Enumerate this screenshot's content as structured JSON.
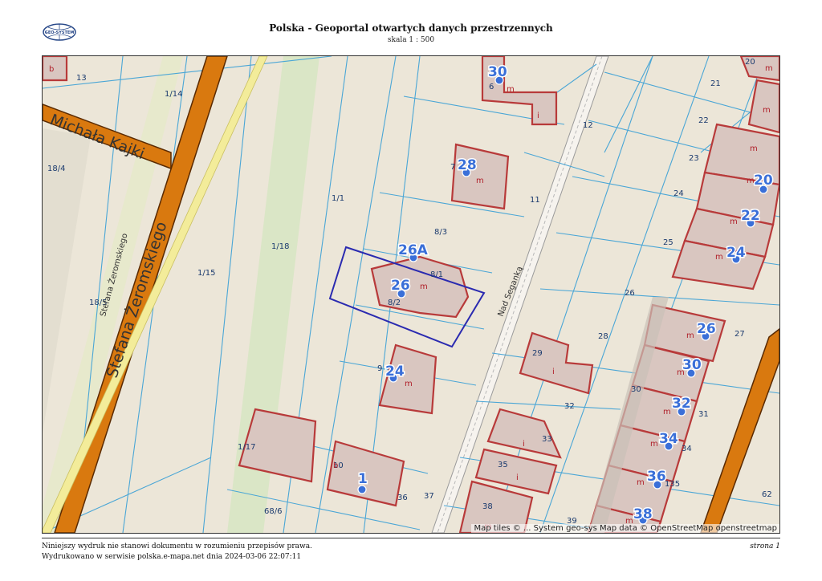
{
  "header": {
    "title": "Polska - Geoportal otwartych danych przestrzennych",
    "scale": "skala 1 : 500",
    "logo_text": "GEO-SYSTEM"
  },
  "map": {
    "streets": [
      "Michała Kajki",
      "Stefana Żeromskiego",
      "Stefana Żeromskiego",
      "Nad Seganką"
    ],
    "parcels": [
      "13",
      "1/14",
      "18/4",
      "1/1",
      "1/18",
      "1/15",
      "18/5",
      "8/3",
      "8/1",
      "8/2",
      "1/17",
      "10",
      "68/6",
      "36",
      "37",
      "38",
      "39",
      "11",
      "12",
      "20",
      "21",
      "22",
      "23",
      "24",
      "25",
      "26",
      "27",
      "28",
      "29",
      "30",
      "31",
      "32",
      "33",
      "34",
      "35",
      "135",
      "62",
      "6",
      "7",
      "9"
    ],
    "house_numbers": [
      "30",
      "28",
      "26A",
      "26",
      "24",
      "1",
      "20",
      "22",
      "24",
      "26",
      "30",
      "32",
      "34",
      "36",
      "38"
    ],
    "building_labels": {
      "m": "m",
      "i": "i",
      "b": "b"
    },
    "attribution": "Map tiles © ... System geo-sys Map data © OpenStreetMap openstreetmap"
  },
  "colors": {
    "background": "#ece6d8",
    "parcel_line": "#4aa6d6",
    "building_fill": "#d9c6c0",
    "building_stroke": "#b83a3a",
    "road_main": "#d9790f",
    "selection": "#2a2ab0",
    "house_number": "#3a6fd8"
  },
  "footer": {
    "disclaimer": "Niniejszy wydruk nie stanowi dokumentu w rozumieniu przepisów prawa.",
    "printed": "Wydrukowano w serwisie polska.e-mapa.net dnia 2024-03-06 22:07:11",
    "page": "strona 1"
  }
}
